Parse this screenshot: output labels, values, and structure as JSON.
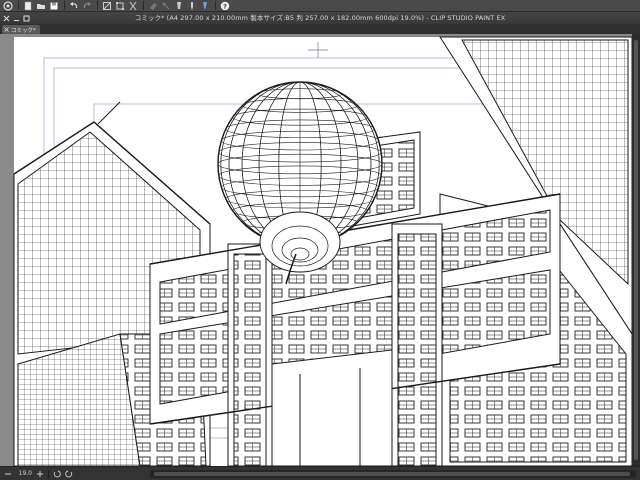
{
  "window": {
    "title": "コミック* (A4 297.00 x 210.00mm 製本サイズ:B5 判 257.00 x 182.00mm 600dpi 19.0%) - CLIP STUDIO PAINT EX"
  },
  "tabs": [
    {
      "label": "コミック*"
    }
  ],
  "toolbar": {
    "icons": [
      "app-menu-icon",
      "new-file-icon",
      "open-file-icon",
      "save-icon",
      "undo-icon",
      "redo-icon",
      "clear-icon",
      "transform-icon",
      "fill-icon",
      "eraser-icon",
      "select-icon",
      "pen-icon",
      "brush-icon",
      "ruler-icon",
      "help-icon"
    ]
  },
  "status": {
    "zoom": "19.0"
  },
  "colors": {
    "canvas": "#ffffff",
    "line": "#1a1a1a",
    "guide": "#9aa0c8",
    "chrome": "#3c3c3c"
  }
}
